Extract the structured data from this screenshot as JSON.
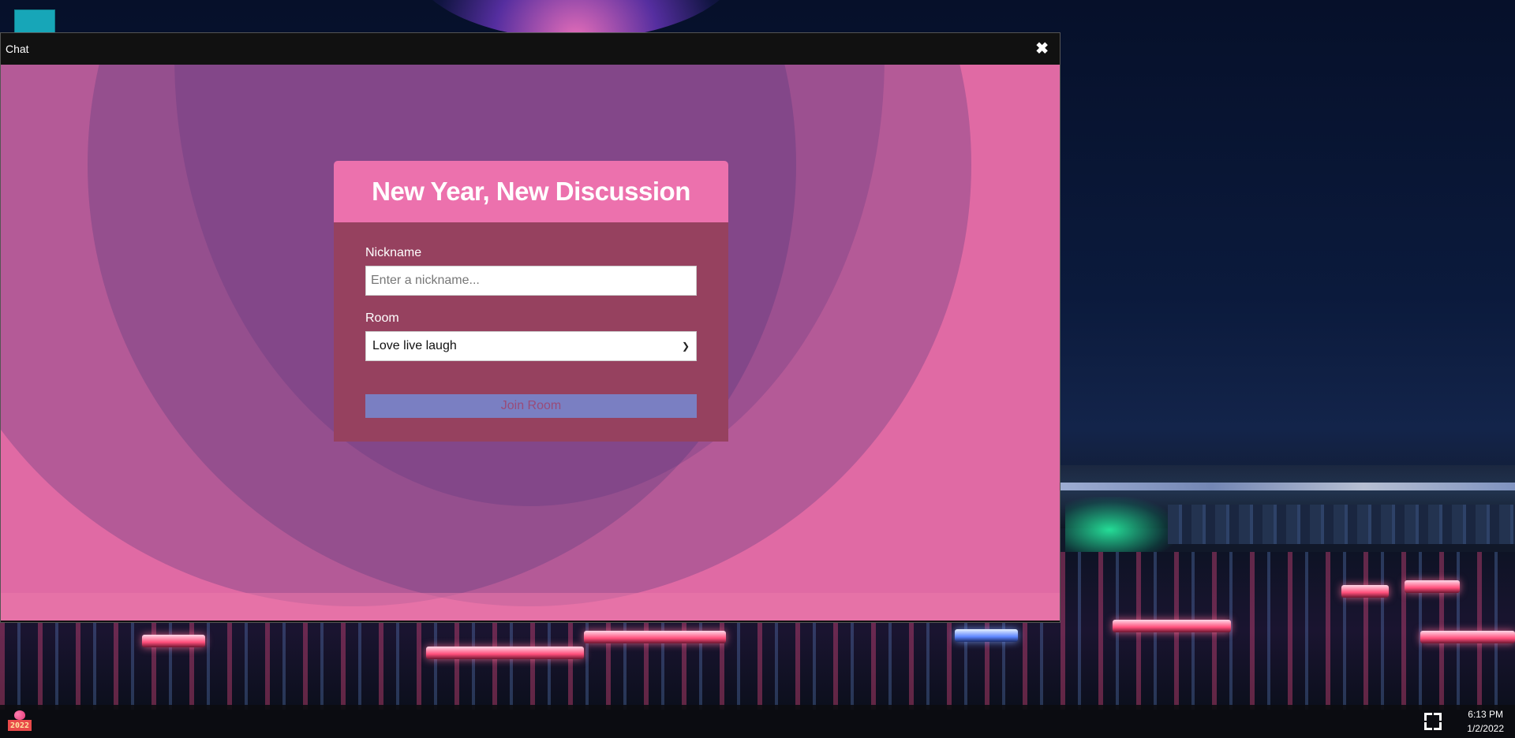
{
  "window": {
    "title": "Chat",
    "close_icon": "✖"
  },
  "join_form": {
    "heading": "New Year, New Discussion",
    "nickname_label": "Nickname",
    "nickname_placeholder": "Enter a nickname...",
    "nickname_value": "",
    "room_label": "Room",
    "room_selected": "Love live laugh",
    "join_button_label": "Join Room"
  },
  "taskbar": {
    "start_icon_text": "2022",
    "fullscreen_icon": "fullscreen-icon",
    "time": "6:13 PM",
    "date": "1/2/2022"
  },
  "colors": {
    "window_background": "#e06aa4",
    "card_header": "#ec71ad",
    "card_body": "#96415f",
    "join_button": "#7a7fc2",
    "titlebar": "#111111"
  }
}
